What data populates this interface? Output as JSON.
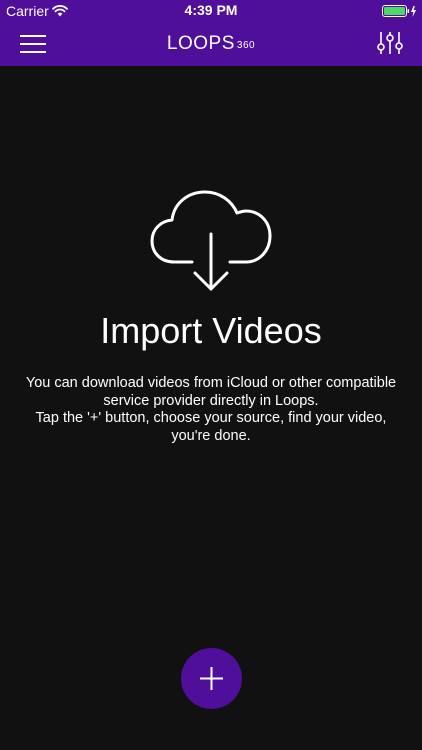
{
  "status_bar": {
    "carrier": "Carrier",
    "time": "4:39 PM",
    "wifi_icon": "wifi-icon",
    "battery_icon": "battery-icon"
  },
  "nav": {
    "menu_icon": "hamburger-menu-icon",
    "logo_text": "LOOPS",
    "logo_suffix": "360",
    "filter_icon": "sliders-icon"
  },
  "empty_state": {
    "icon": "cloud-download-icon",
    "title": "Import Videos",
    "line1": "You can download videos from iCloud or other compatible service provider directly in Loops.",
    "line2": "Tap the '+' button, choose your source, find your video, you're done."
  },
  "add_button": {
    "icon": "plus-icon"
  },
  "colors": {
    "accent": "#4f0f9b",
    "background": "#121112",
    "battery": "#4cd964",
    "text": "#ffffff"
  }
}
